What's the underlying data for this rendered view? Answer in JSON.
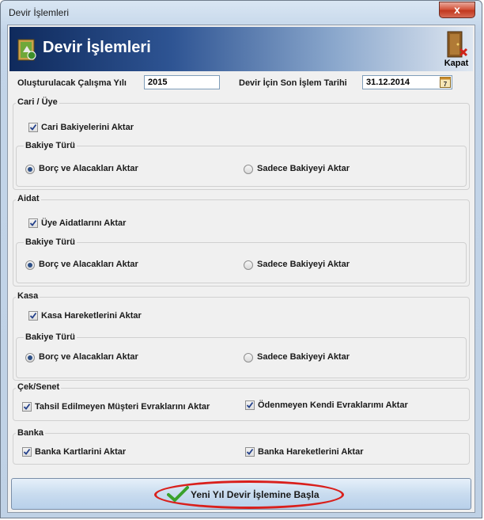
{
  "window": {
    "title": "Devir İşlemleri",
    "close_symbol": "x"
  },
  "header": {
    "title": "Devir İşlemleri",
    "close_label": "Kapat"
  },
  "year_field": {
    "label": "Oluşturulacak Çalışma Yılı",
    "value": "2015"
  },
  "date_field": {
    "label": "Devir İçin Son İşlem Tarihi",
    "value": "31.12.2014",
    "calendar_day": "7"
  },
  "cari": {
    "title": "Cari / Üye",
    "checkbox_label": "Cari Bakiyelerini Aktar",
    "bakiye_title": "Bakiye Türü",
    "radio_left": "Borç ve Alacakları Aktar",
    "radio_right": "Sadece Bakiyeyi Aktar"
  },
  "aidat": {
    "title": "Aidat",
    "checkbox_label": "Üye Aidatlarını Aktar",
    "bakiye_title": "Bakiye Türü",
    "radio_left": "Borç ve Alacakları Aktar",
    "radio_right": "Sadece Bakiyeyi Aktar"
  },
  "kasa": {
    "title": "Kasa",
    "checkbox_label": "Kasa Hareketlerini Aktar",
    "bakiye_title": "Bakiye Türü",
    "radio_left": "Borç ve Alacakları Aktar",
    "radio_right": "Sadece Bakiyeyi Aktar"
  },
  "cek": {
    "title": "Çek/Senet",
    "left_label": "Tahsil Edilmeyen Müşteri Evraklarını Aktar",
    "right_label": "Ödenmeyen Kendi Evraklarımı Aktar"
  },
  "banka": {
    "title": "Banka",
    "left_label": "Banka Kartlarini Aktar",
    "right_label": "Banka Hareketlerini Aktar"
  },
  "start_button": {
    "label": "Yeni Yıl Devir İşlemine Başla"
  },
  "colors": {
    "banner": "#2e5493",
    "highlight": "#d9201c",
    "check": "#3aa12b"
  }
}
